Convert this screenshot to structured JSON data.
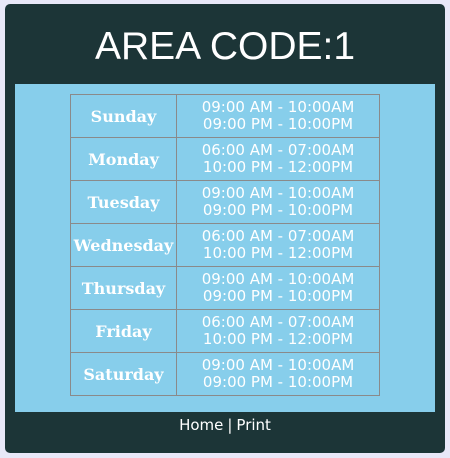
{
  "header": {
    "title": "AREA CODE:1"
  },
  "schedule": [
    {
      "day": "Sunday",
      "slot1": "09:00 AM - 10:00AM",
      "slot2": "09:00 PM - 10:00PM"
    },
    {
      "day": "Monday",
      "slot1": "06:00 AM - 07:00AM",
      "slot2": "10:00 PM - 12:00PM"
    },
    {
      "day": "Tuesday",
      "slot1": "09:00 AM - 10:00AM",
      "slot2": "09:00 PM - 10:00PM"
    },
    {
      "day": "Wednesday",
      "slot1": "06:00 AM - 07:00AM",
      "slot2": "10:00 PM - 12:00PM"
    },
    {
      "day": "Thursday",
      "slot1": "09:00 AM - 10:00AM",
      "slot2": "09:00 PM - 10:00PM"
    },
    {
      "day": "Friday",
      "slot1": "06:00 AM - 07:00AM",
      "slot2": "10:00 PM - 12:00PM"
    },
    {
      "day": "Saturday",
      "slot1": "09:00 AM - 10:00AM",
      "slot2": "09:00 PM - 10:00PM"
    }
  ],
  "footer": {
    "home_label": "Home",
    "separator": "|",
    "print_label": "Print"
  },
  "colors": {
    "page_background": "#e8e8f8",
    "panel_background": "#1c3537",
    "content_background": "#87ceeb",
    "table_border": "#8a8a8a",
    "text": "#ffffff"
  }
}
